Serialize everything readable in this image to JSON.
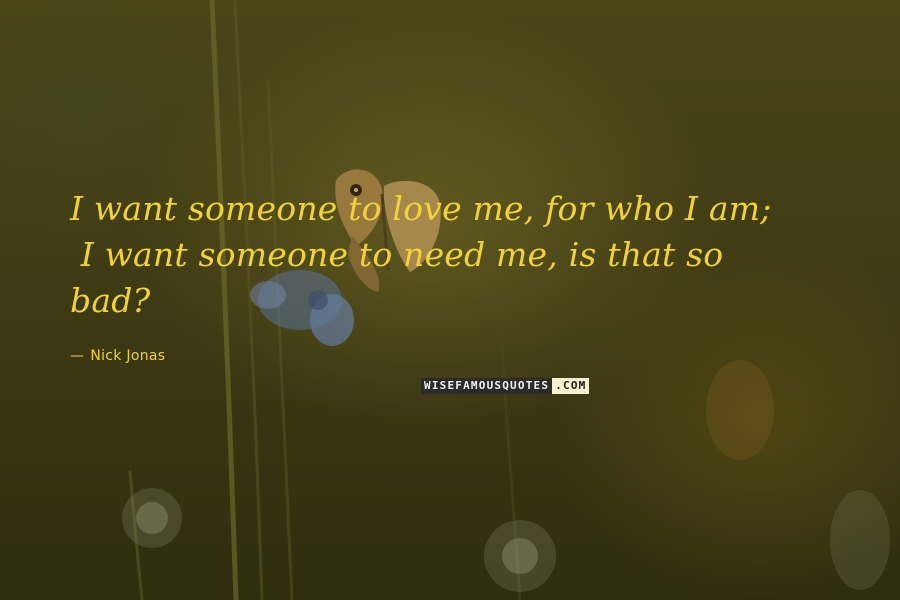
{
  "image": {
    "quote_lines": [
      "I want someone to love me, for who I am;",
      " I want someone to need me, is that so",
      "bad?"
    ],
    "author": "Nick Jonas",
    "author_prefix": "—",
    "watermark_left": "WISEFAMOUSQUOTES",
    "watermark_right": ".COM"
  },
  "colors": {
    "text": "#f2d23a",
    "background": "#3f3b14",
    "butterfly": "#b08a4a",
    "flower": "#6f8fd0"
  }
}
